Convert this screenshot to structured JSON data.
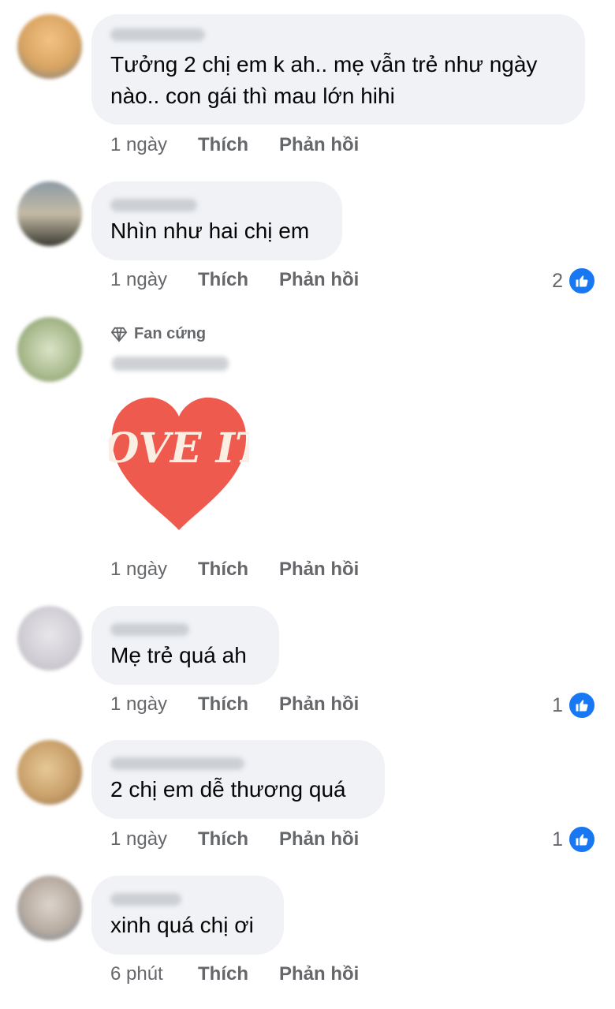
{
  "comments": [
    {
      "text": "Tưởng 2 chị em k ah.. mẹ vẫn trẻ như ngày nào.. con gái thì mau lớn hihi",
      "time": "1 ngày",
      "like": "Thích",
      "reply": "Phản hồi",
      "reactions": ""
    },
    {
      "text": "Nhìn như hai chị em",
      "time": "1 ngày",
      "like": "Thích",
      "reply": "Phản hồi",
      "reactions": "2"
    },
    {
      "badge": "Fan cứng",
      "sticker": "LOVE IT!",
      "time": "1 ngày",
      "like": "Thích",
      "reply": "Phản hồi",
      "reactions": ""
    },
    {
      "text": "Mẹ trẻ quá ah",
      "time": "1 ngày",
      "like": "Thích",
      "reply": "Phản hồi",
      "reactions": "1"
    },
    {
      "text": "2 chị em dễ thương quá",
      "time": "1 ngày",
      "like": "Thích",
      "reply": "Phản hồi",
      "reactions": "1"
    },
    {
      "text": "xinh quá chị ơi",
      "time": "6 phút",
      "like": "Thích",
      "reply": "Phản hồi",
      "reactions": ""
    }
  ],
  "colors": {
    "accent": "#1877f2",
    "bubble": "#f0f2f5",
    "muted": "#65676b",
    "sticker": "#ef5a4f"
  },
  "icons": [
    "diamond-icon",
    "like-thumb-icon"
  ]
}
